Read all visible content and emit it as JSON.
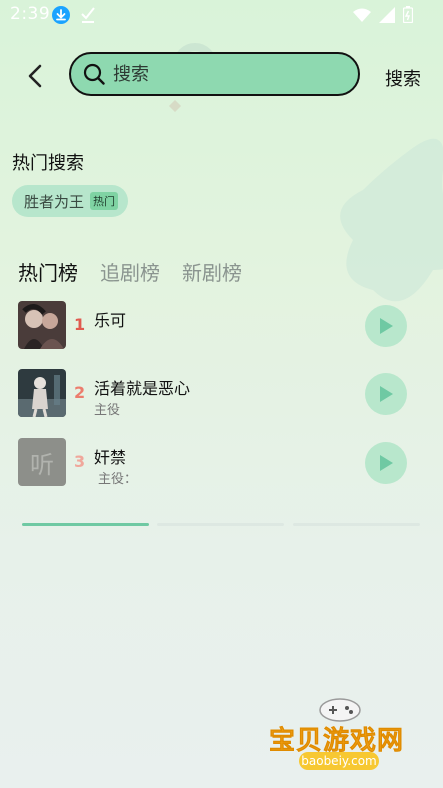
{
  "status_bar": {
    "time": "2:39",
    "icons": [
      "download-icon",
      "check-icon",
      "wifi-icon",
      "signal-icon",
      "battery-icon"
    ]
  },
  "header": {
    "back_icon": "chevron-left-icon",
    "search_placeholder": "搜索",
    "search_button_label": "搜索"
  },
  "hot_search": {
    "title": "热门搜索",
    "chips": [
      {
        "label": "胜者为王",
        "tag": "热门"
      }
    ]
  },
  "tabs": [
    {
      "label": "热门榜",
      "active": true
    },
    {
      "label": "追剧榜",
      "active": false
    },
    {
      "label": "新剧榜",
      "active": false
    }
  ],
  "ranking": [
    {
      "rank": "1",
      "title": "乐可",
      "subtitle": "",
      "rank_color": "#e05a4f"
    },
    {
      "rank": "2",
      "title": "活着就是恶心",
      "subtitle": "主役",
      "rank_color": "#ec7d6d"
    },
    {
      "rank": "3",
      "title": "奸禁",
      "subtitle": "主役：",
      "rank_color": "#f0a79b"
    }
  ],
  "placeholder_cover_text": "听",
  "pager": {
    "count": 3,
    "active_index": 0
  },
  "watermark": {
    "text": "宝贝游戏网",
    "url": "baobeiy.com"
  },
  "colors": {
    "accent": "#8ed9b0",
    "play_button": "#b8e7cc",
    "pager_active": "#6fc9a3"
  }
}
